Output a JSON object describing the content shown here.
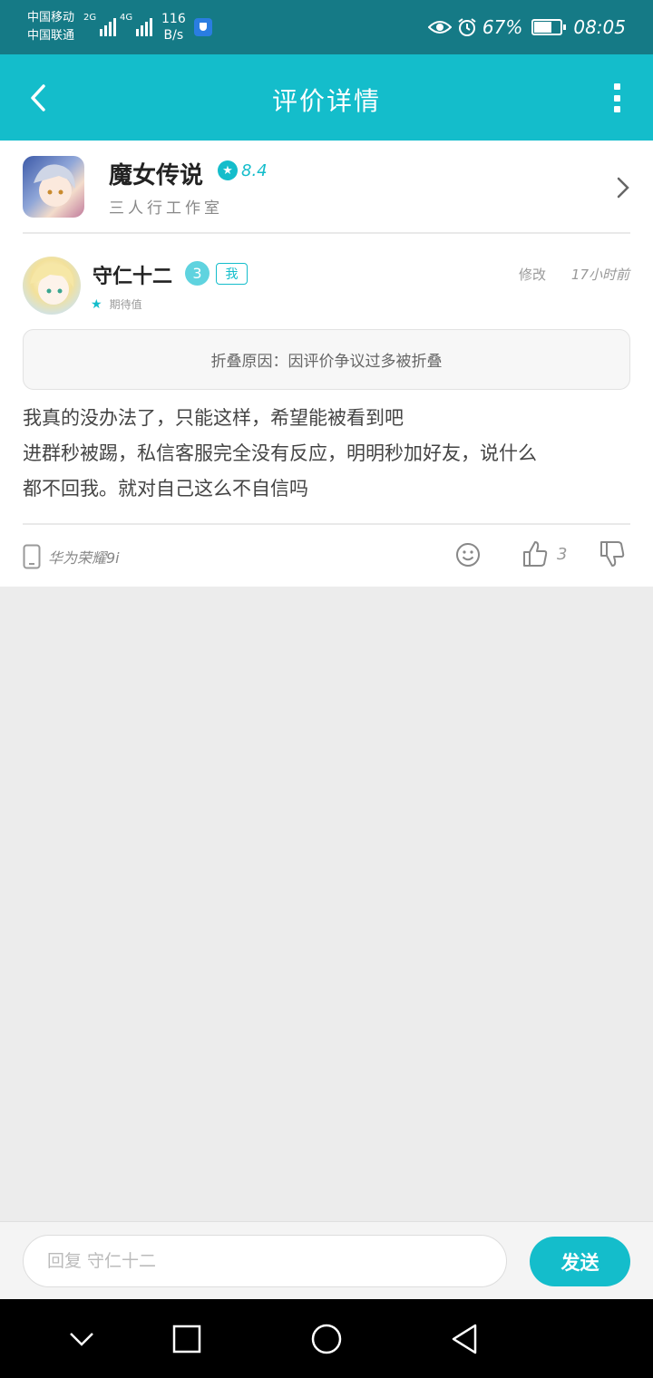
{
  "status_bar": {
    "carrier_1": "中国移动",
    "carrier_2": "中国联通",
    "network_1": "2G",
    "network_2": "4G",
    "speed_value": "116",
    "speed_unit": "B/s",
    "battery_percent": "67%",
    "battery_level": 0.67,
    "time": "08:05"
  },
  "header": {
    "title": "评价详情"
  },
  "game": {
    "name": "魔女传说",
    "rating": "8.4",
    "developer": "三人行工作室"
  },
  "review": {
    "user_name": "守仁十二",
    "level": "3",
    "me_tag": "我",
    "edit_label": "修改",
    "time_ago": "17小时前",
    "expect_label": "期待值",
    "fold_reason": "折叠原因：因评价争议过多被折叠",
    "text_lines": [
      "我真的没办法了，只能这样，希望能被看到吧",
      "进群秒被踢，私信客服完全没有反应，明明秒加好友，说什么",
      "都不回我。就对自己这么不自信吗"
    ],
    "device": "华为荣耀9i",
    "like_count": "3"
  },
  "reply": {
    "placeholder": "回复 守仁十二",
    "send_label": "发送"
  },
  "colors": {
    "accent": "#14bdcb",
    "status_bar": "#157a86"
  },
  "icons": [
    "eye-icon",
    "alarm-icon",
    "battery-icon",
    "shield-icon",
    "back-arrow-icon",
    "more-vertical-icon",
    "chevron-right-icon",
    "star-icon",
    "phone-icon",
    "emoji-icon",
    "thumbs-up-icon",
    "thumbs-down-icon",
    "nav-back-icon",
    "nav-home-icon",
    "nav-recent-icon"
  ]
}
